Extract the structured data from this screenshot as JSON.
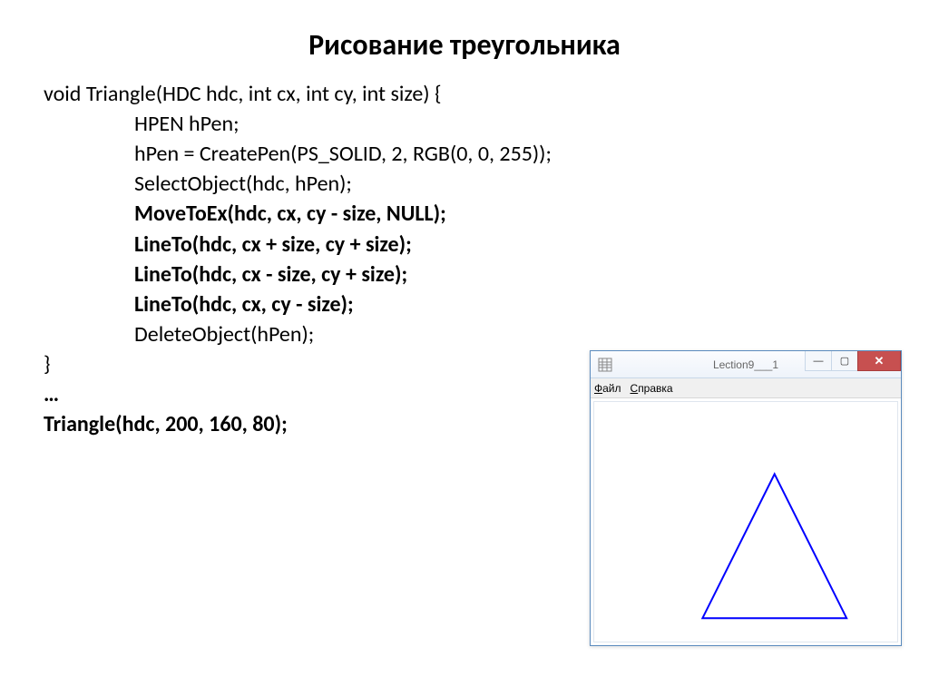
{
  "slide": {
    "title": "Рисование треугольника"
  },
  "code": {
    "l1": "void Triangle(HDC hdc, int cx, int cy, int size) {",
    "l2": "HPEN hPen;",
    "l3": "hPen = CreatePen(PS_SOLID, 2, RGB(0, 0, 255));",
    "l4": "SelectObject(hdc, hPen);",
    "l5": "",
    "l6": "MoveToEx(hdc, cx, cy - size, NULL);",
    "l7": "LineTo(hdc, cx + size, cy + size);",
    "l8": "LineTo(hdc, cx - size, cy + size);",
    "l9": "LineTo(hdc, cx, cy - size);",
    "l10": "",
    "l11": "DeleteObject(hPen);",
    "l12": "}",
    "l13": "…",
    "l14": "Triangle(hdc, 200, 160, 80);"
  },
  "window": {
    "title": "Lection9___1",
    "minimize": "—",
    "maximize": "▢",
    "close": "✕",
    "menu": {
      "file_u": "Ф",
      "file_rest": "айл",
      "help_u": "С",
      "help_rest": "правка"
    },
    "icon_glyph": "⊞"
  }
}
